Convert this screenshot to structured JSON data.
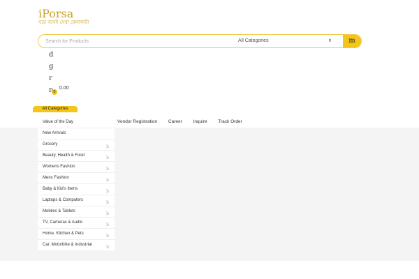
{
  "logo": {
    "title": "iPorsa",
    "subtitle": "ঘরে বসেই সেরা কেনাকাটা"
  },
  "search": {
    "placeholder": "Search for Products",
    "category_selected": "All Categories",
    "button_glyph": "m"
  },
  "header_icons": [
    "d",
    "g",
    "r",
    "n"
  ],
  "cart": {
    "badge": "0",
    "total": "0.00"
  },
  "categories_tab": "All Categories",
  "menu": [
    {
      "label": "Value of the Day",
      "arrow": ""
    },
    {
      "label": "New Arrivals",
      "arrow": ""
    },
    {
      "label": "Grocery",
      "arrow": "b"
    },
    {
      "label": "Beauty, Health & Food",
      "arrow": "b"
    },
    {
      "label": "Womens Fashion",
      "arrow": "b"
    },
    {
      "label": "Mens Fashion",
      "arrow": "b"
    },
    {
      "label": "Baby & Kid's Items",
      "arrow": "b"
    },
    {
      "label": "Laptops & Computers",
      "arrow": "b"
    },
    {
      "label": "Mobiles & Tablets",
      "arrow": "b"
    },
    {
      "label": "TV, Cameras & Audio",
      "arrow": "b"
    },
    {
      "label": "Home, Kitchen & Pets",
      "arrow": "b"
    },
    {
      "label": "Car, Motorbike & Industrial",
      "arrow": "b"
    }
  ],
  "topnav": [
    "Vendor Registration",
    "Career",
    "Inquire",
    "Track Order"
  ],
  "colors": {
    "accent": "#f5c518",
    "logo": "#c9a227",
    "band": "#f4f4f4"
  }
}
